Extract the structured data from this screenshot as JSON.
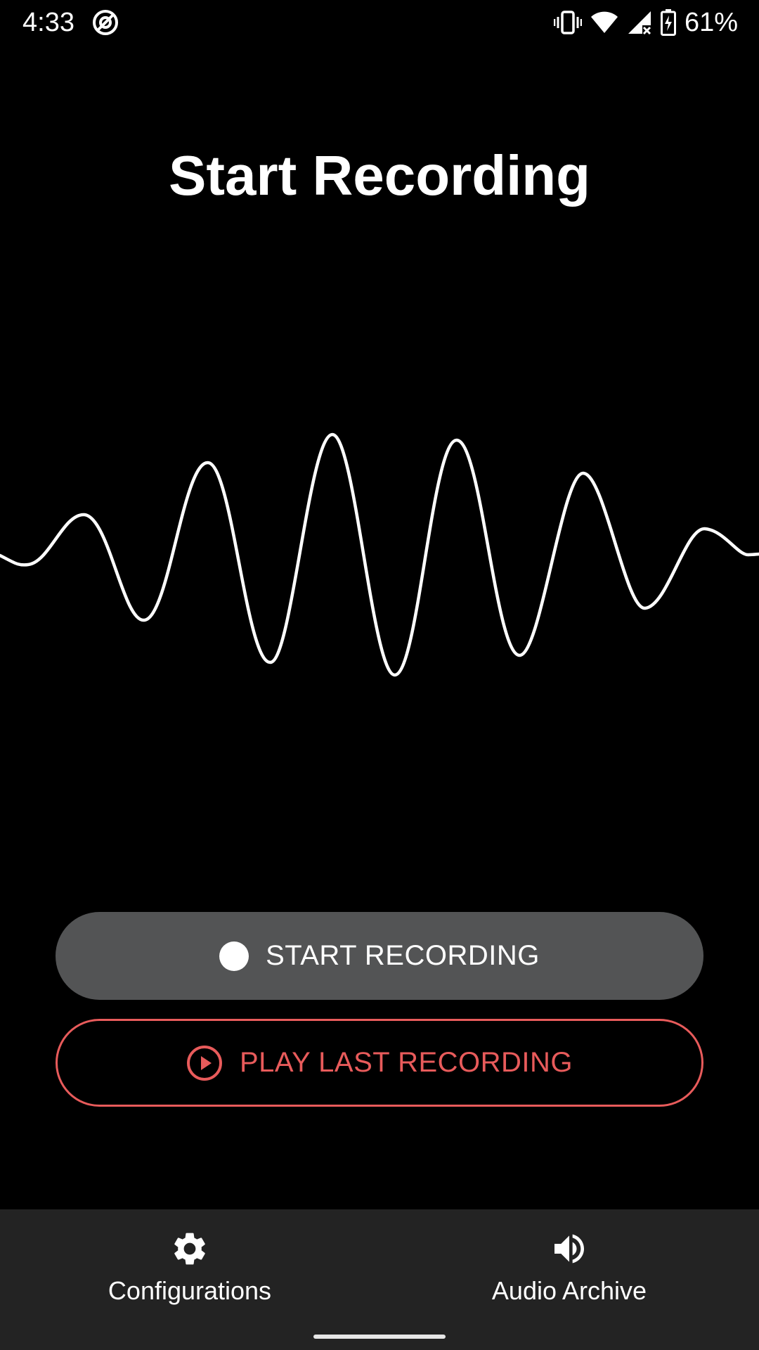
{
  "status_bar": {
    "time": "4:33",
    "battery_percent": "61%",
    "icons": [
      "assistant-icon",
      "vibrate-icon",
      "wifi-icon",
      "cellular-no-signal-icon",
      "battery-charging-icon"
    ]
  },
  "page": {
    "title": "Start Recording"
  },
  "buttons": {
    "start_recording": "START RECORDING",
    "play_last_recording": "PLAY LAST RECORDING"
  },
  "bottom_nav": {
    "items": [
      {
        "label": "Configurations",
        "icon": "gear-icon"
      },
      {
        "label": "Audio Archive",
        "icon": "speaker-icon"
      }
    ]
  },
  "colors": {
    "background": "#000000",
    "record_button": "#535455",
    "accent_red": "#e85b5b",
    "nav_background": "#232323"
  }
}
